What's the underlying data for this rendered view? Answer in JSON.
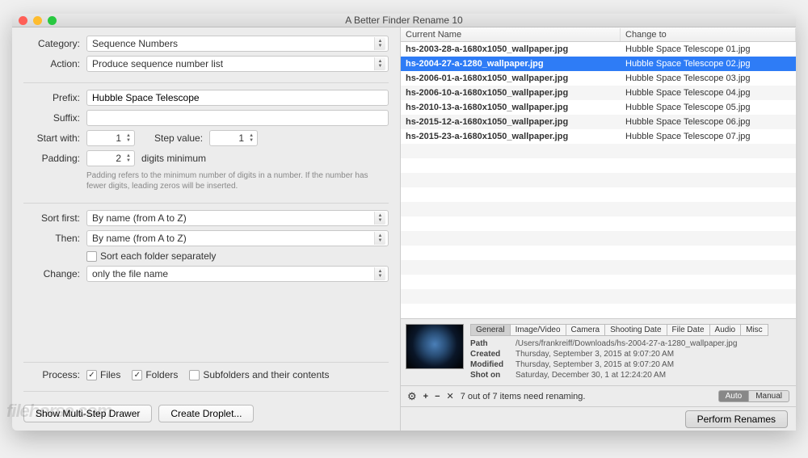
{
  "window": {
    "title": "A Better Finder Rename 10"
  },
  "top": {
    "category_label": "Category:",
    "category_value": "Sequence Numbers",
    "action_label": "Action:",
    "action_value": "Produce sequence number list"
  },
  "fields": {
    "prefix_label": "Prefix:",
    "prefix_value": "Hubble Space Telescope",
    "suffix_label": "Suffix:",
    "suffix_value": "",
    "start_label": "Start with:",
    "start_value": "1",
    "step_label": "Step value:",
    "step_value": "1",
    "padding_label": "Padding:",
    "padding_value": "2",
    "padding_suffix": "digits minimum",
    "padding_help": "Padding refers to the minimum number of digits in a number. If the number has fewer digits, leading zeros will be inserted.",
    "sort_first_label": "Sort first:",
    "sort_first_value": "By name (from A to Z)",
    "then_label": "Then:",
    "then_value": "By name (from A to Z)",
    "sort_each_label": "Sort each folder separately",
    "change_label": "Change:",
    "change_value": "only the file name"
  },
  "process": {
    "label": "Process:",
    "files": "Files",
    "folders": "Folders",
    "subfolders": "Subfolders and their contents"
  },
  "buttons": {
    "multistep": "Show Multi-Step Drawer",
    "droplet": "Create Droplet...",
    "perform": "Perform Renames"
  },
  "table": {
    "col1": "Current Name",
    "col2": "Change to",
    "rows": [
      {
        "cur": "hs-2003-28-a-1680x1050_wallpaper.jpg",
        "new": "Hubble Space Telescope 01.jpg",
        "sel": false
      },
      {
        "cur": "hs-2004-27-a-1280_wallpaper.jpg",
        "new": "Hubble Space Telescope 02.jpg",
        "sel": true
      },
      {
        "cur": "hs-2006-01-a-1680x1050_wallpaper.jpg",
        "new": "Hubble Space Telescope 03.jpg",
        "sel": false
      },
      {
        "cur": "hs-2006-10-a-1680x1050_wallpaper.jpg",
        "new": "Hubble Space Telescope 04.jpg",
        "sel": false
      },
      {
        "cur": "hs-2010-13-a-1680x1050_wallpaper.jpg",
        "new": "Hubble Space Telescope 05.jpg",
        "sel": false
      },
      {
        "cur": "hs-2015-12-a-1680x1050_wallpaper.jpg",
        "new": "Hubble Space Telescope 06.jpg",
        "sel": false
      },
      {
        "cur": "hs-2015-23-a-1680x1050_wallpaper.jpg",
        "new": "Hubble Space Telescope 07.jpg",
        "sel": false
      }
    ]
  },
  "detail": {
    "tabs": [
      "General",
      "Image/Video",
      "Camera",
      "Shooting Date",
      "File Date",
      "Audio",
      "Misc"
    ],
    "active_tab": 0,
    "path_k": "Path",
    "path_v": "/Users/frankreiff/Downloads/hs-2004-27-a-1280_wallpaper.jpg",
    "created_k": "Created",
    "created_v": "Thursday, September 3, 2015 at 9:07:20 AM",
    "modified_k": "Modified",
    "modified_v": "Thursday, September 3, 2015 at 9:07:20 AM",
    "shot_k": "Shot on",
    "shot_v": "Saturday, December 30, 1 at 12:24:20 AM"
  },
  "status": {
    "text": "7 out of 7 items need renaming.",
    "auto": "Auto",
    "manual": "Manual"
  },
  "watermark": "filehorse.com"
}
